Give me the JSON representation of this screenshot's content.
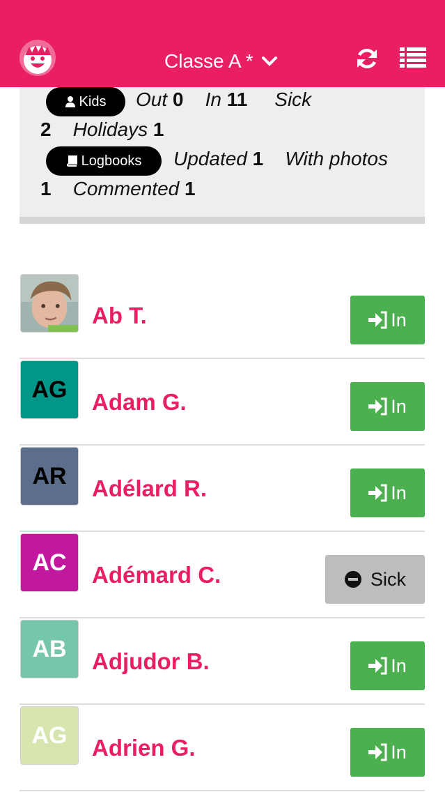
{
  "header": {
    "title": "Classe A *"
  },
  "stats": {
    "kids_label": "Kids",
    "out_label": "Out",
    "out_value": "0",
    "in_label": "In",
    "in_value": "11",
    "sick_label": "Sick",
    "sick_value": "2",
    "holidays_label": "Holidays",
    "holidays_value": "1",
    "logbooks_label": "Logbooks",
    "updated_label": "Updated",
    "updated_value": "1",
    "photos_label": "With photos",
    "photos_value": "1",
    "commented_label": "Commented",
    "commented_value": "1"
  },
  "kids": [
    {
      "initials": "",
      "name": "Ab T.",
      "status": "In",
      "avatar_color": "photo",
      "initials_color": ""
    },
    {
      "initials": "AG",
      "name": "Adam G.",
      "status": "In",
      "avatar_color": "#009688",
      "initials_color": "#000000"
    },
    {
      "initials": "AR",
      "name": "Adélard R.",
      "status": "In",
      "avatar_color": "#5D6E8C",
      "initials_color": "#000000"
    },
    {
      "initials": "AC",
      "name": "Adémard C.",
      "status": "Sick",
      "avatar_color": "#C2189F",
      "initials_color": "#ffffff"
    },
    {
      "initials": "AB",
      "name": "Adjudor B.",
      "status": "In",
      "avatar_color": "#76C6AD",
      "initials_color": "#ffffff"
    },
    {
      "initials": "AG",
      "name": "Adrien G.",
      "status": "In",
      "avatar_color": "#D7E6AE",
      "initials_color": "#ffffff"
    }
  ],
  "colors": {
    "brand": "#E91E63",
    "in_button": "#4CAF50",
    "sick_button": "#BDBDBF"
  },
  "icons": [
    "smiley-logo-icon",
    "chevron-down-icon",
    "refresh-icon",
    "list-icon",
    "user-icon",
    "book-icon",
    "sign-in-icon",
    "minus-circle-icon"
  ]
}
